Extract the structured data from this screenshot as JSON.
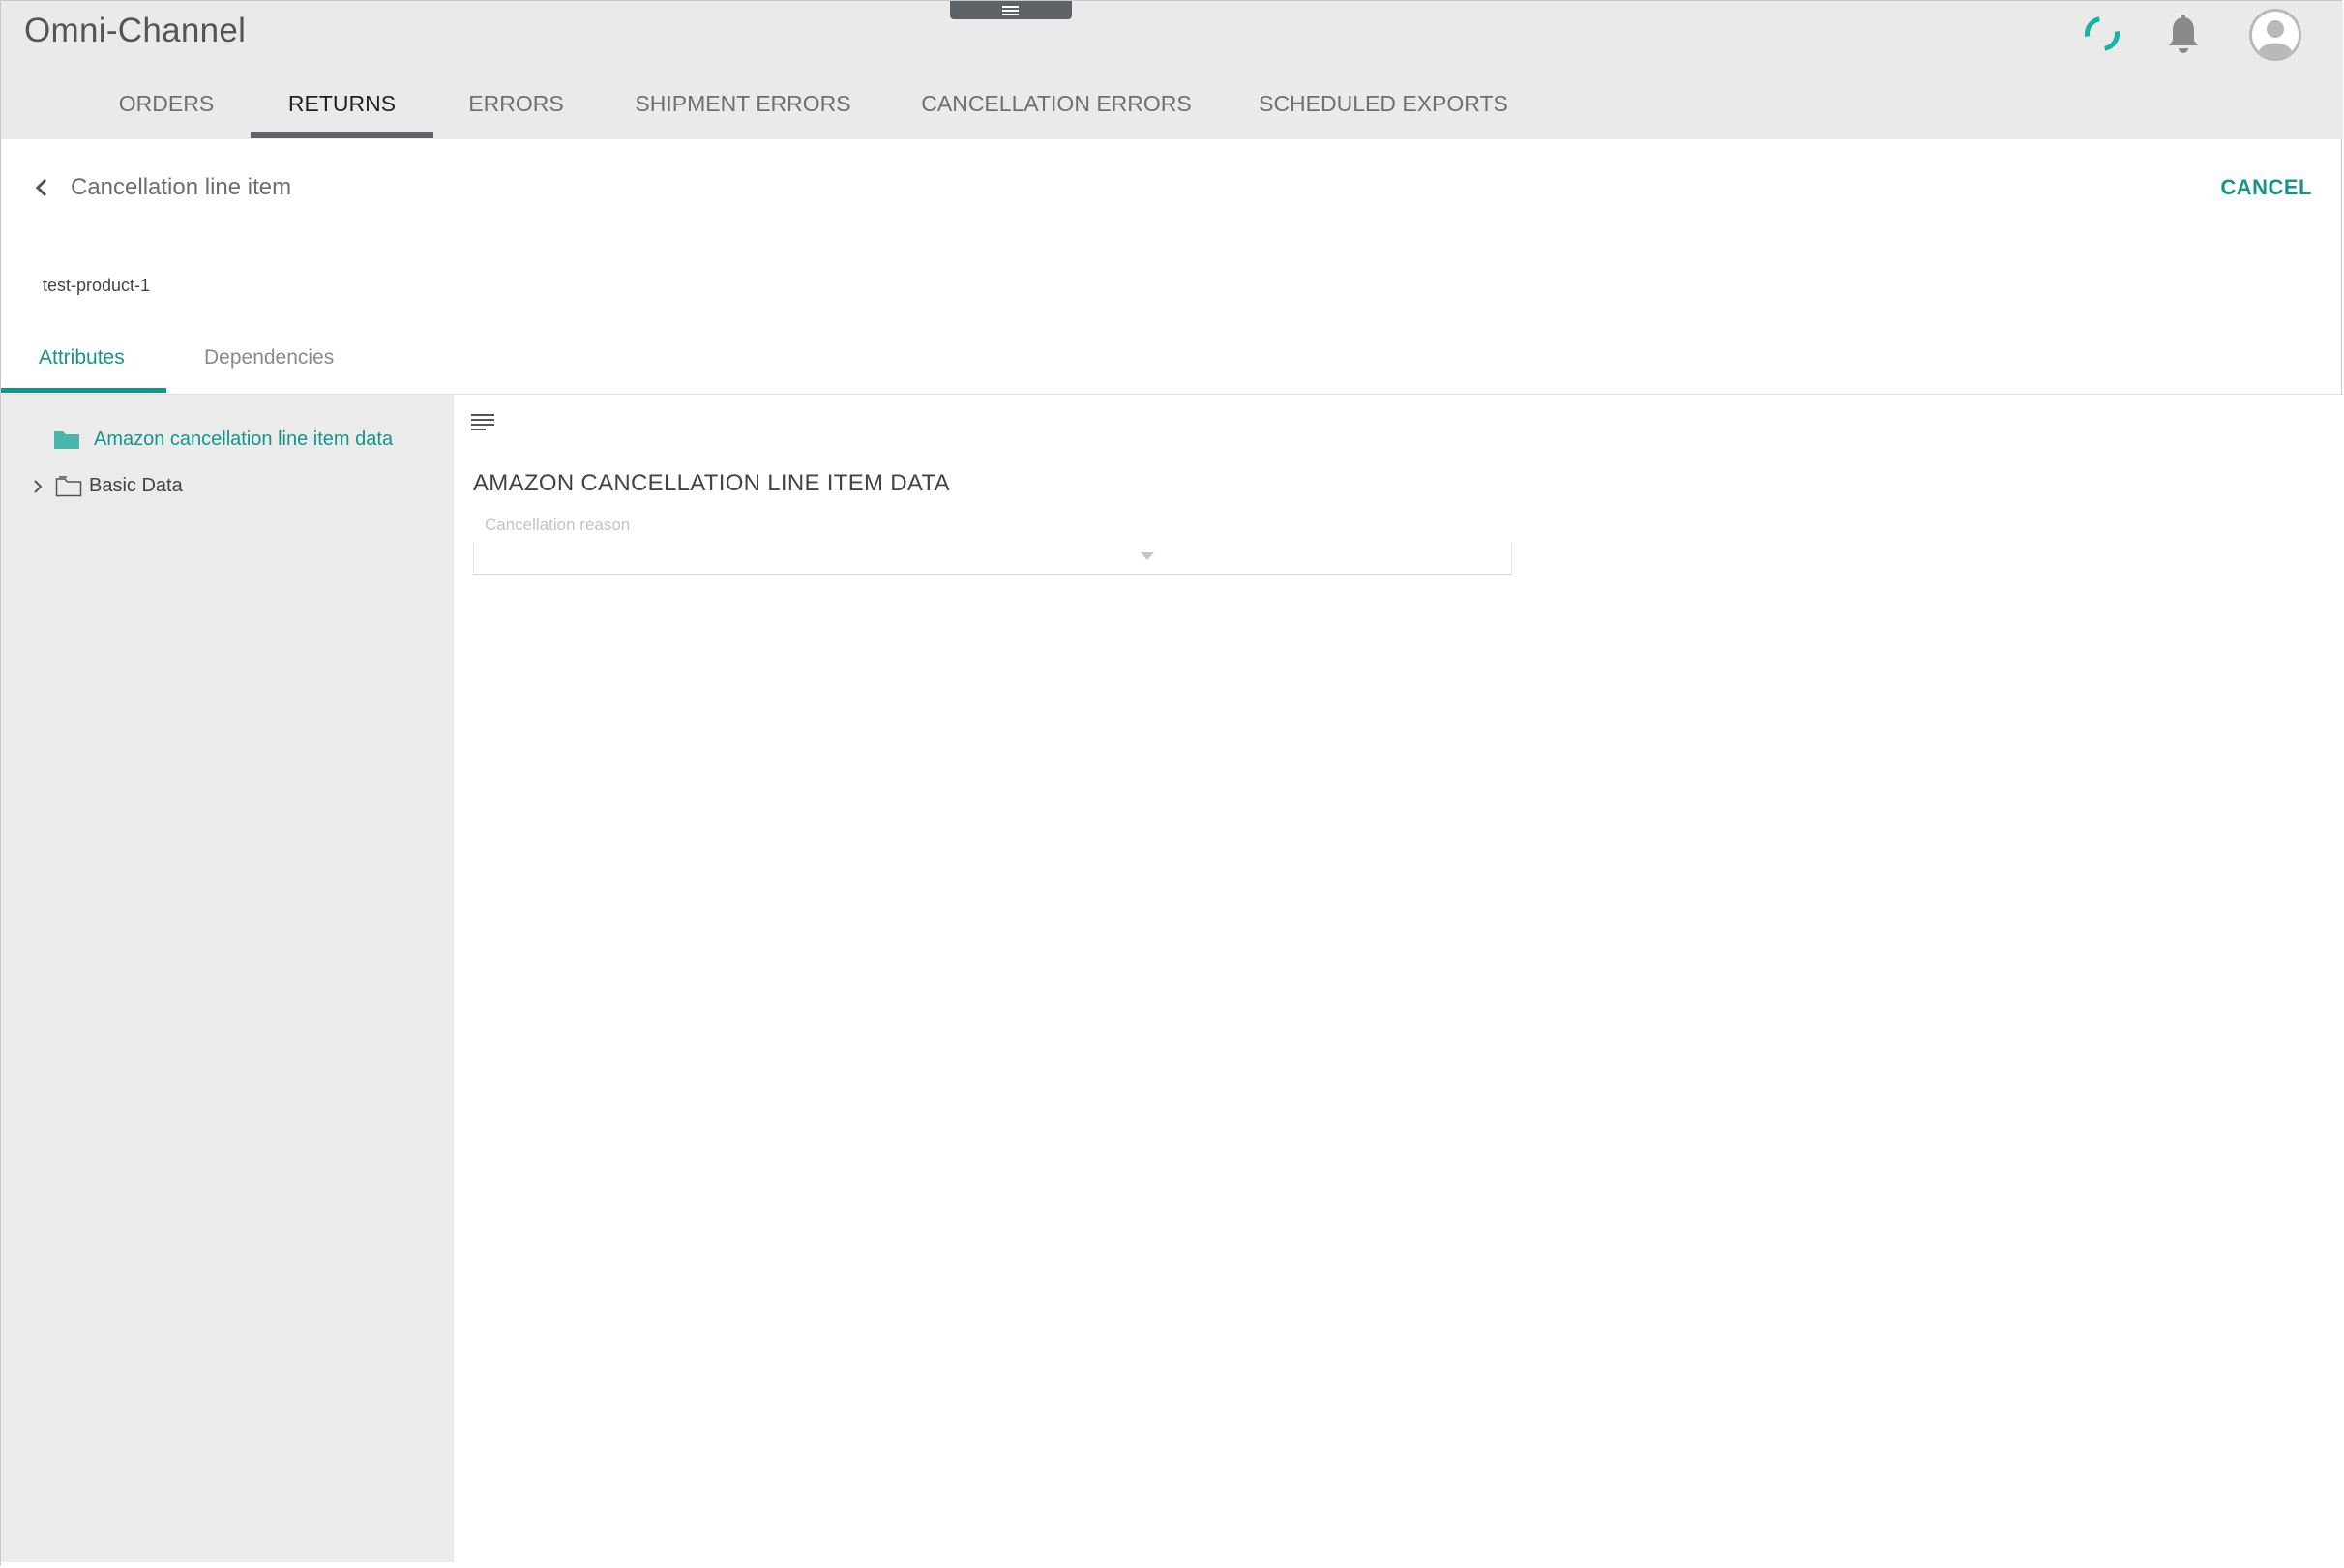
{
  "app": {
    "title": "Omni-Channel"
  },
  "header": {
    "icons": [
      "menu-handle-icon",
      "loading-spinner-icon",
      "bell-icon",
      "user-avatar-icon"
    ],
    "accent_color": "#19b3a6"
  },
  "main_tabs": [
    {
      "label": "ORDERS",
      "active": false
    },
    {
      "label": "RETURNS",
      "active": true
    },
    {
      "label": "ERRORS",
      "active": false
    },
    {
      "label": "SHIPMENT ERRORS",
      "active": false
    },
    {
      "label": "CANCELLATION ERRORS",
      "active": false
    },
    {
      "label": "SCHEDULED EXPORTS",
      "active": false
    }
  ],
  "page": {
    "title": "Cancellation line item",
    "cancel_label": "CANCEL",
    "product_id": "test-product-1"
  },
  "sub_tabs": [
    {
      "label": "Attributes",
      "active": true
    },
    {
      "label": "Dependencies",
      "active": false
    }
  ],
  "tree": [
    {
      "label": "Amazon cancellation line item data",
      "selected": true,
      "icon": "folder-filled-icon"
    },
    {
      "label": "Basic Data",
      "selected": false,
      "icon": "folder-outline-icon",
      "expandable": true
    }
  ],
  "section": {
    "title": "AMAZON CANCELLATION LINE ITEM DATA",
    "field_label": "Cancellation reason",
    "field_value": ""
  },
  "colors": {
    "teal": "#14968c",
    "topbar": "#eaeaea",
    "sidebar": "#ebebeb"
  }
}
